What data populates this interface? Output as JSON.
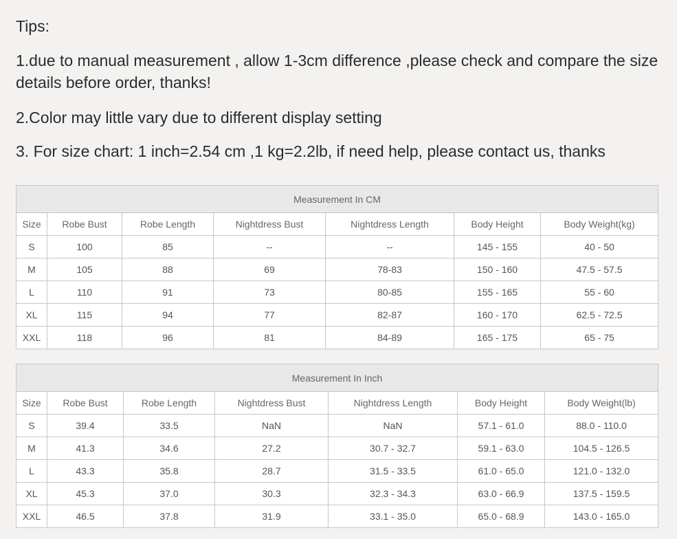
{
  "tips": {
    "title": "Tips:",
    "line1": "1.due to manual measurement , allow 1-3cm difference ,please check and compare the size details before order, thanks!",
    "line2": "2.Color may little vary due to different display setting",
    "line3": "3. For size chart: 1 inch=2.54 cm ,1 kg=2.2lb, if need help, please contact us, thanks"
  },
  "table_cm": {
    "caption": "Measurement In CM",
    "headers": [
      "Size",
      "Robe Bust",
      "Robe Length",
      "Nightdress Bust",
      "Nightdress Length",
      "Body Height",
      "Body Weight(kg)"
    ],
    "rows": [
      [
        "S",
        "100",
        "85",
        "--",
        "--",
        "145 - 155",
        "40 - 50"
      ],
      [
        "M",
        "105",
        "88",
        "69",
        "78-83",
        "150 - 160",
        "47.5 - 57.5"
      ],
      [
        "L",
        "110",
        "91",
        "73",
        "80-85",
        "155 - 165",
        "55 - 60"
      ],
      [
        "XL",
        "115",
        "94",
        "77",
        "82-87",
        "160 - 170",
        "62.5 - 72.5"
      ],
      [
        "XXL",
        "118",
        "96",
        "81",
        "84-89",
        "165 - 175",
        "65 - 75"
      ]
    ]
  },
  "table_inch": {
    "caption": "Measurement In Inch",
    "headers": [
      "Size",
      "Robe Bust",
      "Robe Length",
      "Nightdress Bust",
      "Nightdress Length",
      "Body Height",
      "Body Weight(lb)"
    ],
    "rows": [
      [
        "S",
        "39.4",
        "33.5",
        "NaN",
        "NaN",
        "57.1 - 61.0",
        "88.0 - 110.0"
      ],
      [
        "M",
        "41.3",
        "34.6",
        "27.2",
        "30.7 - 32.7",
        "59.1 - 63.0",
        "104.5 - 126.5"
      ],
      [
        "L",
        "43.3",
        "35.8",
        "28.7",
        "31.5 - 33.5",
        "61.0 - 65.0",
        "121.0 - 132.0"
      ],
      [
        "XL",
        "45.3",
        "37.0",
        "30.3",
        "32.3 - 34.3",
        "63.0 - 66.9",
        "137.5 - 159.5"
      ],
      [
        "XXL",
        "46.5",
        "37.8",
        "31.9",
        "33.1 - 35.0",
        "65.0 - 68.9",
        "143.0 - 165.0"
      ]
    ]
  }
}
